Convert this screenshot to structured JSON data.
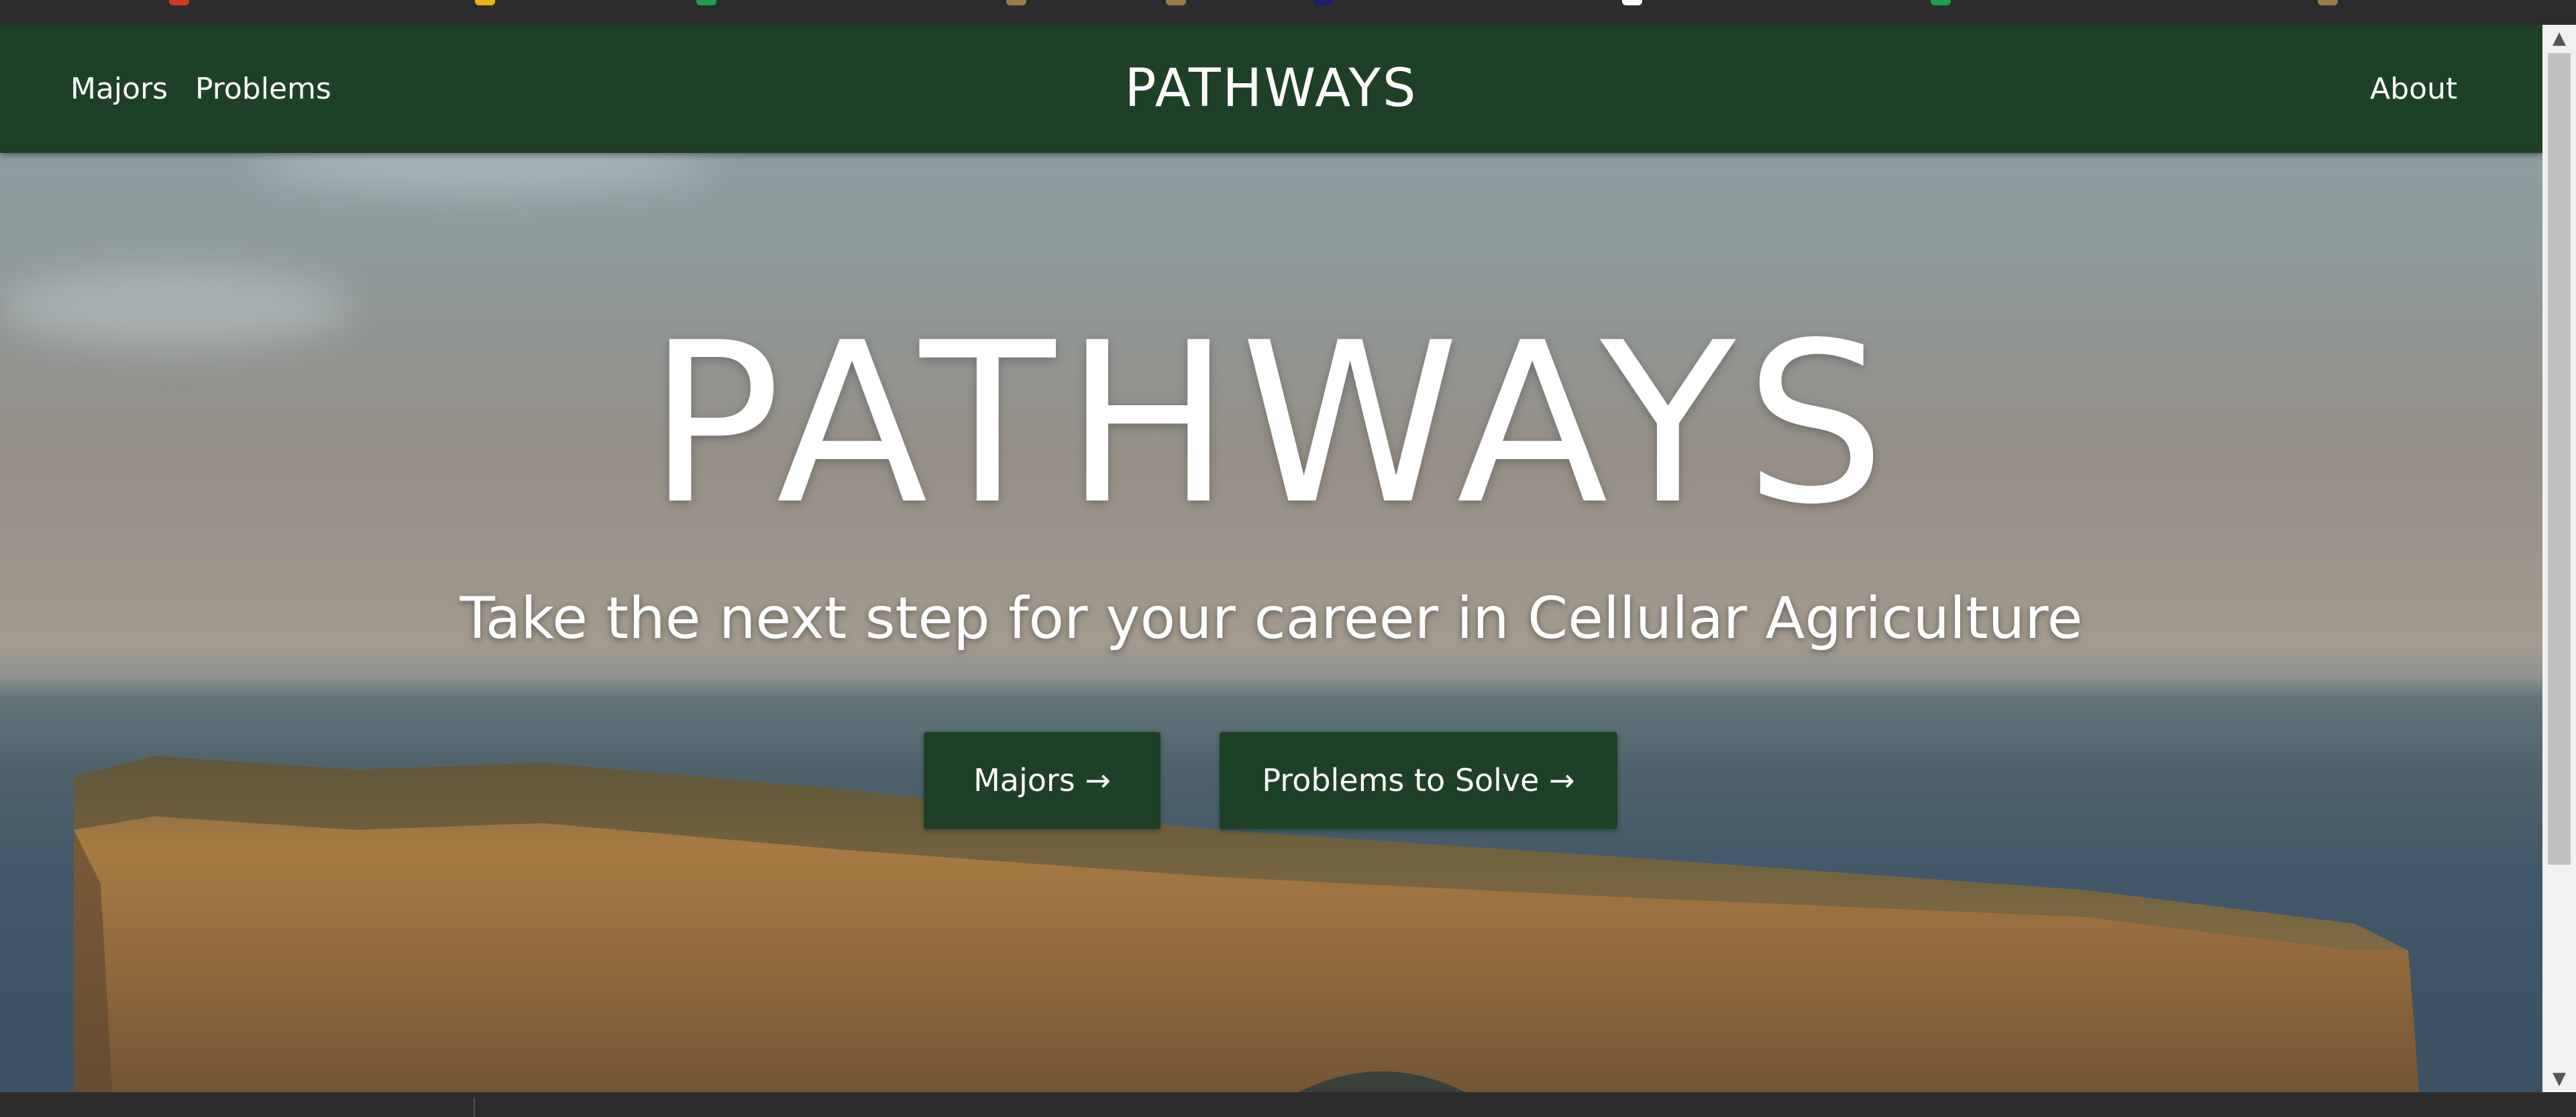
{
  "nav": {
    "left_links": [
      "Majors",
      "Problems"
    ],
    "brand": "PATHWAYS",
    "right_link": "About"
  },
  "hero": {
    "title": "PATHWAYS",
    "subtitle": "Take the next step for your career in Cellular Agriculture",
    "buttons": {
      "majors": "Majors →",
      "problems": "Problems to Solve →"
    }
  },
  "colors": {
    "nav_bg": "#1e4027",
    "button_bg": "#1e4027",
    "text": "#ffffff"
  },
  "icons": {
    "scroll_up": "scroll-up-arrow-icon",
    "scroll_down": "scroll-down-arrow-icon"
  }
}
